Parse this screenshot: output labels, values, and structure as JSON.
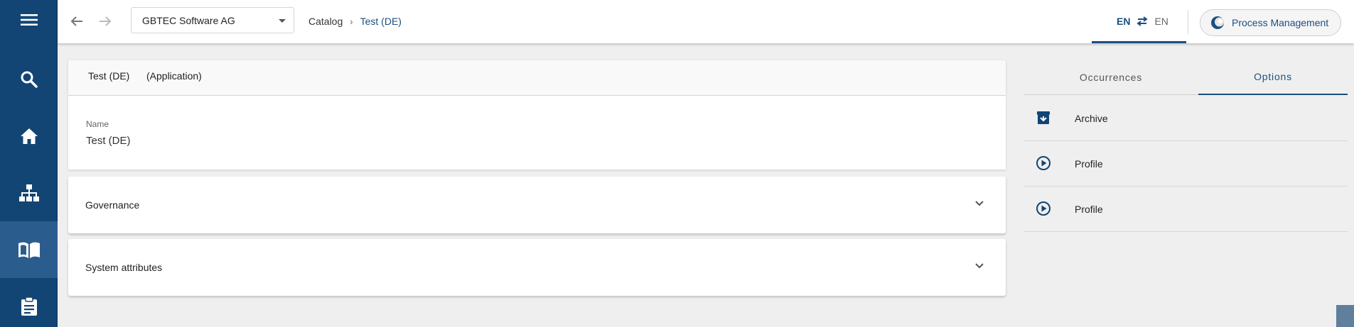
{
  "colors": {
    "sidebar": "#124574",
    "sidebar_active": "#2a5d8d",
    "accent": "#1a4f80",
    "background": "#efefef"
  },
  "sidebar": {
    "items": [
      {
        "icon": "menu-icon"
      },
      {
        "icon": "search-icon"
      },
      {
        "icon": "home-icon"
      },
      {
        "icon": "hierarchy-icon"
      },
      {
        "icon": "book-icon",
        "active": true
      },
      {
        "icon": "clipboard-icon"
      }
    ]
  },
  "topbar": {
    "company_select": {
      "value": "GBTEC Software AG"
    },
    "breadcrumb": {
      "items": [
        "Catalog",
        "Test (DE)"
      ],
      "separator": "›"
    },
    "language": {
      "primary": "EN",
      "secondary": "EN"
    },
    "process_management_label": "Process Management"
  },
  "main": {
    "header": {
      "title": "Test (DE)",
      "type": "(Application)"
    },
    "name_field": {
      "label": "Name",
      "value": "Test (DE)"
    },
    "panels": [
      {
        "title": "Governance"
      },
      {
        "title": "System attributes"
      }
    ]
  },
  "right": {
    "tabs": [
      {
        "label": "Occurrences",
        "active": false
      },
      {
        "label": "Options",
        "active": true
      }
    ],
    "options": [
      {
        "label": "Archive",
        "icon": "archive-icon"
      },
      {
        "label": "Profile",
        "icon": "play-circle-icon"
      },
      {
        "label": "Profile",
        "icon": "play-circle-icon"
      }
    ]
  }
}
